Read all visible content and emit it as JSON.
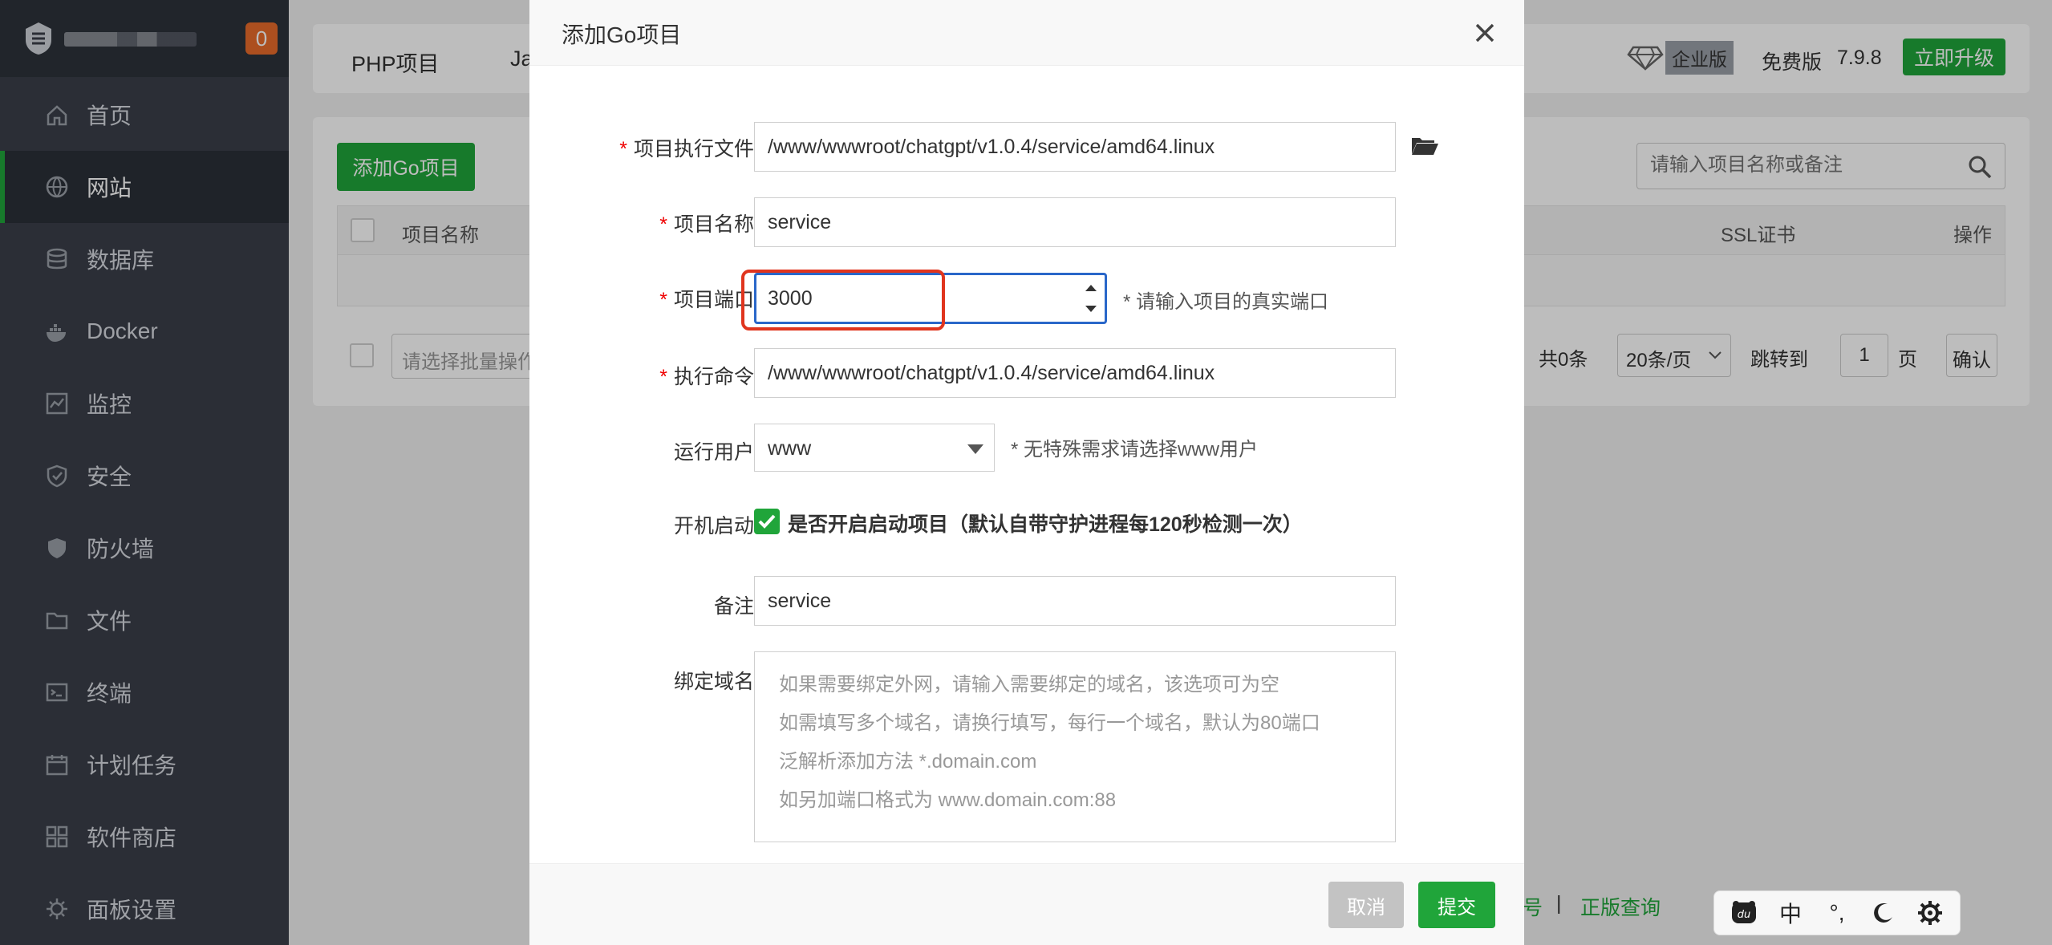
{
  "sidebar": {
    "badge": "0",
    "items": [
      {
        "label": "首页",
        "icon": "home-icon"
      },
      {
        "label": "网站",
        "icon": "globe-icon"
      },
      {
        "label": "数据库",
        "icon": "database-icon"
      },
      {
        "label": "Docker",
        "icon": "docker-icon"
      },
      {
        "label": "监控",
        "icon": "monitor-icon"
      },
      {
        "label": "安全",
        "icon": "shield-check-icon"
      },
      {
        "label": "防火墙",
        "icon": "shield-icon"
      },
      {
        "label": "文件",
        "icon": "folder-icon"
      },
      {
        "label": "终端",
        "icon": "terminal-icon"
      },
      {
        "label": "计划任务",
        "icon": "calendar-icon"
      },
      {
        "label": "软件商店",
        "icon": "grid-icon"
      },
      {
        "label": "面板设置",
        "icon": "gear-icon"
      }
    ],
    "active_index": 1
  },
  "topbar": {
    "tab_php": "PHP项目",
    "tab_java": "Ja",
    "enterprise": "企业版",
    "free": "免费版",
    "version": "7.9.8",
    "upgrade": "立即升级"
  },
  "panel": {
    "add_button": "添加Go项目",
    "search_placeholder": "请输入项目名称或备注",
    "col_name": "项目名称",
    "col_ssl": "SSL证书",
    "col_action": "操作",
    "batch_placeholder": "请选择批量操作",
    "total": "共0条",
    "per_page": "20条/页",
    "jump_to": "跳转到",
    "page_value": "1",
    "page_unit": "页",
    "confirm": "确认"
  },
  "footer": {
    "link1": "号",
    "sep": "|",
    "link2": "正版查询"
  },
  "modal": {
    "title": "添加Go项目",
    "exec_file_label": "项目执行文件",
    "exec_file_value": "/www/wwwroot/chatgpt/v1.0.4/service/amd64.linux",
    "name_label": "项目名称",
    "name_value": "service",
    "port_label": "项目端口",
    "port_value": "3000",
    "port_hint": "* 请输入项目的真实端口",
    "cmd_label": "执行命令",
    "cmd_value": "/www/wwwroot/chatgpt/v1.0.4/service/amd64.linux",
    "user_label": "运行用户",
    "user_value": "www",
    "user_hint": "* 无特殊需求请选择www用户",
    "autostart_label": "开机启动",
    "autostart_text": "是否开启启动项目（默认自带守护进程每120秒检测一次）",
    "autostart_checked": true,
    "remark_label": "备注",
    "remark_value": "service",
    "domain_label": "绑定域名",
    "domain_placeholder": [
      "如果需要绑定外网，请输入需要绑定的域名，该选项可为空",
      "如需填写多个域名，请换行填写，每行一个域名，默认为80端口",
      "泛解析添加方法 *.domain.com",
      "如另加端口格式为 www.domain.com:88"
    ],
    "cancel": "取消",
    "submit": "提交"
  },
  "ime": {
    "zh": "中",
    "punct": "°,"
  },
  "colors": {
    "brand_green": "#20a53a",
    "sidebar_bg": "#3a3f4a",
    "focus_blue": "#2a67c9",
    "highlight_red": "#e0351e"
  }
}
